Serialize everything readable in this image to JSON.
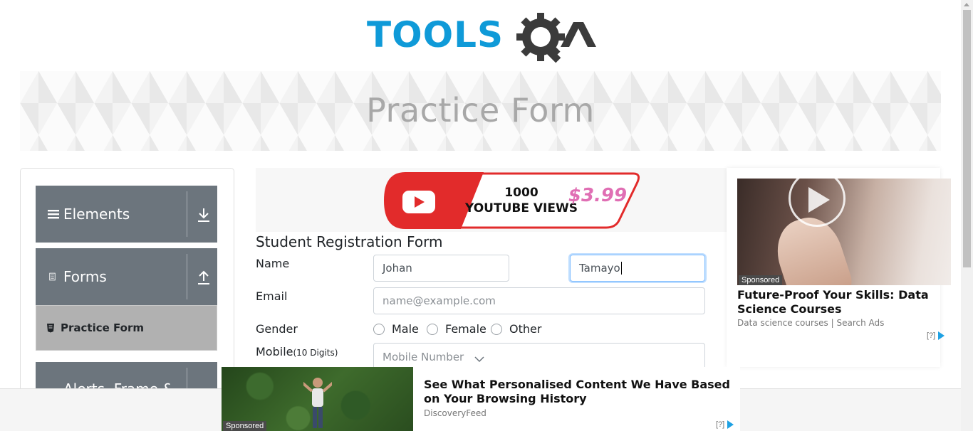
{
  "logo": {
    "brand": "TOOLSQA",
    "colors": {
      "tools": "#0f9ad8",
      "qa": "#3b3b3b"
    }
  },
  "banner": {
    "title": "Practice Form"
  },
  "sidebar": {
    "groups": [
      {
        "label": "Elements",
        "icon": "list-icon",
        "toggle": "arrow-down-icon"
      },
      {
        "label": "Forms",
        "icon": "document-icon",
        "toggle": "arrow-up-icon"
      },
      {
        "label": "Alerts, Frame &",
        "icon": "window-icon",
        "toggle": "arrow-down-icon"
      }
    ],
    "active_item": {
      "label": "Practice Form",
      "icon": "form-icon"
    }
  },
  "promo": {
    "line1": "1000",
    "line2": "YOUTUBE VIEWS",
    "price": "$3.99"
  },
  "form": {
    "title": "Student Registration Form",
    "name_label": "Name",
    "first_name_value": "Johan",
    "last_name_value": "Tamayo",
    "email_label": "Email",
    "email_placeholder": "name@example.com",
    "gender_label": "Gender",
    "gender_options": [
      "Male",
      "Female",
      "Other"
    ],
    "mobile_label": "Mobile",
    "mobile_hint": "(10 Digits)",
    "mobile_placeholder": "Mobile Number"
  },
  "right_ad": {
    "sponsored": "Sponsored",
    "title": "Future-Proof Your Skills: Data Science Courses",
    "subtitle": "Data science courses | Search Ads",
    "adchoices": "[?]"
  },
  "bottom_ad": {
    "sponsored": "Sponsored",
    "title": "See What Personalised Content We Have Based on Your Browsing History",
    "subtitle": "DiscoveryFeed",
    "adchoices": "[?]"
  }
}
